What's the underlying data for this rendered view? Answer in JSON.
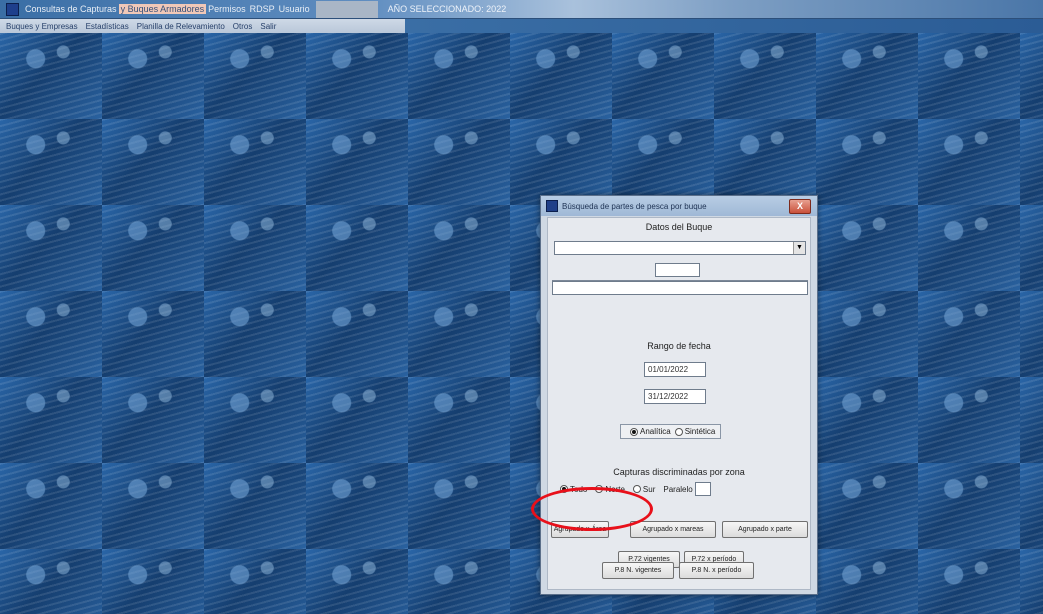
{
  "window": {
    "title_app": "Consultas de Capturas",
    "title_highlight": "y Buques Armadores",
    "title_permisos": "Permisos",
    "title_user_label": "RDSP",
    "title_user": "Usuario",
    "year_label": "AÑO SELECCIONADO: 2022"
  },
  "menu": {
    "items": [
      "Buques y Empresas",
      "Estadísticas",
      "Planilla de Relevamiento",
      "Otros",
      "Salir"
    ]
  },
  "dialog": {
    "title": "Búsqueda de partes de pesca por buque",
    "close_label": "X",
    "section_vessel": "Datos del Buque",
    "combo_arrow": "▼",
    "section_dates": "Rango de fecha",
    "date_from": "01/01/2022",
    "date_to": "31/12/2022",
    "report_options": [
      {
        "label": "Analítica",
        "selected": true
      },
      {
        "label": "Sintética",
        "selected": false
      }
    ],
    "section_zone": "Capturas discriminadas por zona",
    "zone_options": [
      {
        "label": "Todo",
        "selected": true
      },
      {
        "label": "Norte",
        "selected": false
      },
      {
        "label": "Sur",
        "selected": false
      }
    ],
    "parallel_label": "Paralelo",
    "buttons": {
      "group_area": "Agrupado x Área",
      "group_mareas": "Agrupado x mareas",
      "group_parte": "Agrupado x parte",
      "p72_vigentes": "P.72 vigentes",
      "p72_periodo": "P.72 x período",
      "p8_vigentes": "P.8 N. vigentes",
      "p8_periodo": "P.8 N. x período"
    }
  },
  "colors": {
    "highlight_ring": "#e8101a",
    "desktop_blue": "#1e548e",
    "title_bar": "#3a6ea5"
  }
}
